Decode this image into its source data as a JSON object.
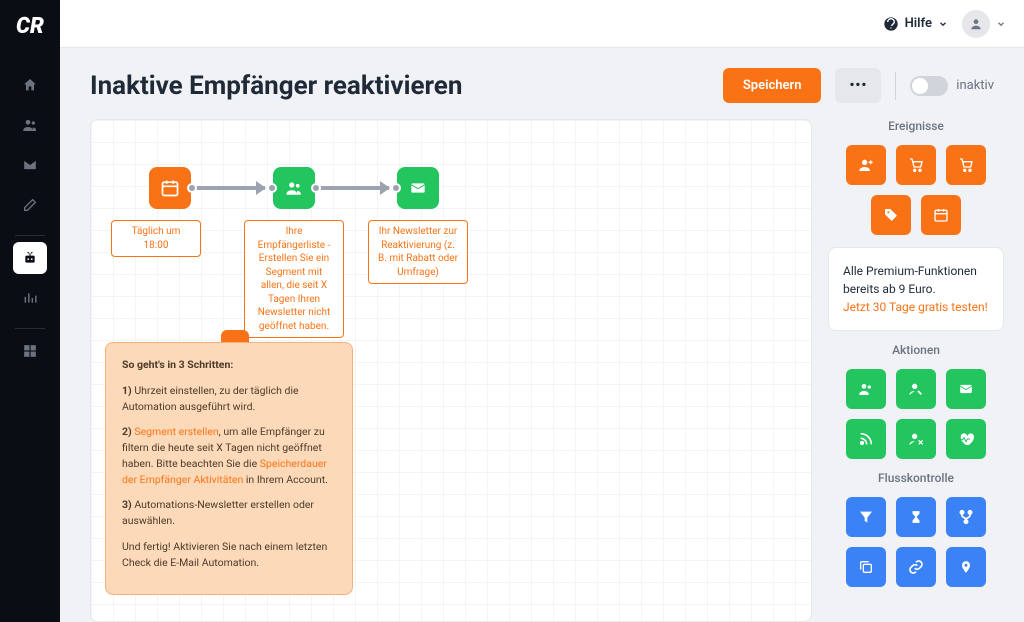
{
  "topbar": {
    "help": "Hilfe"
  },
  "header": {
    "title": "Inaktive Empfänger reaktivieren",
    "save": "Speichern",
    "status": "inaktiv"
  },
  "canvas": {
    "node1_label": "Täglich um 18:00",
    "node2_label": "Ihre Empfängerliste - Erstellen Sie ein Segment mit allen, die seit X Tagen Ihren Newsletter nicht geöffnet haben.",
    "node3_label": "Ihr Newsletter zur Reaktivierung (z. B. mit Rabatt oder Umfrage)"
  },
  "helpbox": {
    "title": "So geht's in 3 Schritten:",
    "s1_a": "1)",
    "s1_b": " Uhrzeit einstellen, zu der täglich die Automation ausgeführt wird.",
    "s2_a": "2) ",
    "s2_link1": "Segment erstellen",
    "s2_b": ", um alle Empfänger zu filtern die heute seit X Tagen nicht geöffnet haben. Bitte beachten Sie die ",
    "s2_link2": "Speicherdauer der Empfänger Aktivitäten",
    "s2_c": " in Ihrem Account.",
    "s3_a": "3)",
    "s3_b": " Automations-Newsletter erstellen oder auswählen.",
    "s4": "Und fertig! Aktivieren Sie nach einem letzten Check die E-Mail Automation."
  },
  "panel": {
    "events_title": "Ereignisse",
    "actions_title": "Aktionen",
    "flow_title": "Flusskontrolle",
    "promo_a": "Alle Premium-Funktionen bereits ab 9 Euro.",
    "promo_link": "Jetzt 30 Tage gratis testen!"
  }
}
